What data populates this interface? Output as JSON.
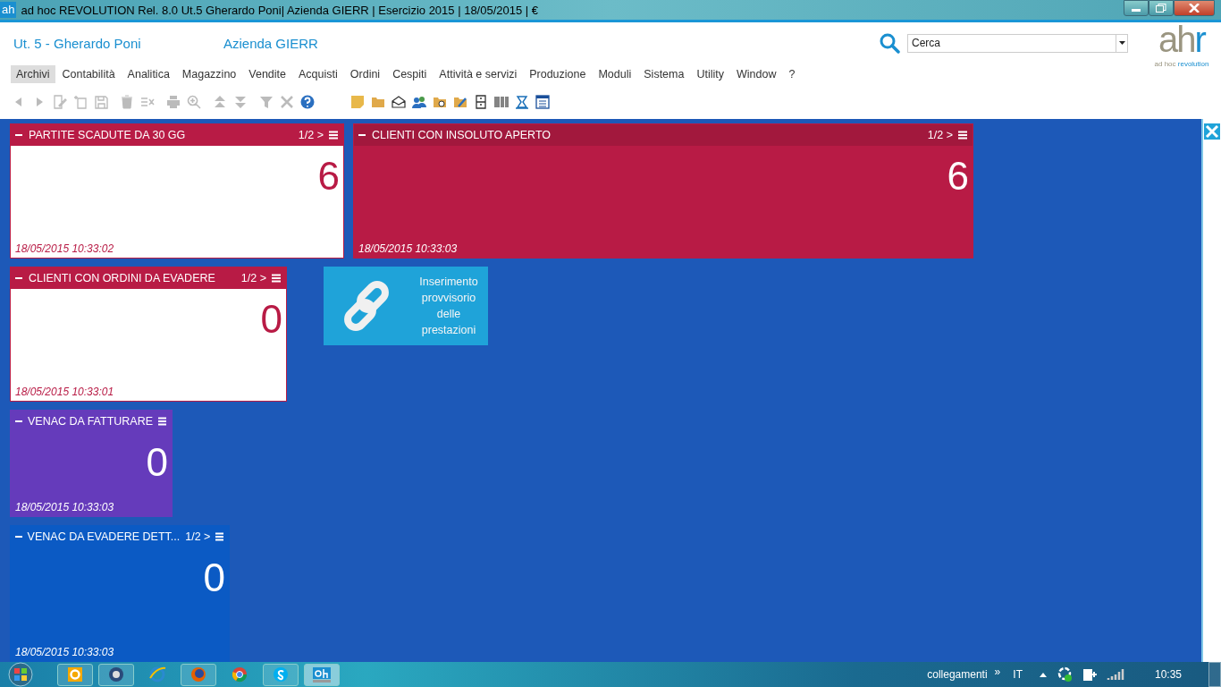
{
  "window": {
    "app_badge": "ah",
    "title": "ad hoc REVOLUTION Rel. 8.0 Ut.5 Gherardo Poni| Azienda GIERR | Esercizio 2015 | 18/05/2015 | €"
  },
  "header": {
    "user": "Ut. 5 - Gherardo Poni",
    "company": "Azienda GIERR",
    "search": {
      "value": "Cerca"
    },
    "logo": {
      "mark_main": "ah",
      "mark_accent": "r",
      "tagline_main": "ad hoc",
      "tagline_accent": "revolution"
    }
  },
  "menu": [
    {
      "label": "Archivi",
      "selected": true
    },
    {
      "label": "Contabilità",
      "selected": false
    },
    {
      "label": "Analitica",
      "selected": false
    },
    {
      "label": "Magazzino",
      "selected": false
    },
    {
      "label": "Vendite",
      "selected": false
    },
    {
      "label": "Acquisti",
      "selected": false
    },
    {
      "label": "Ordini",
      "selected": false
    },
    {
      "label": "Cespiti",
      "selected": false
    },
    {
      "label": "Attività e servizi",
      "selected": false
    },
    {
      "label": "Produzione",
      "selected": false
    },
    {
      "label": "Moduli",
      "selected": false
    },
    {
      "label": "Sistema",
      "selected": false
    },
    {
      "label": "Utility",
      "selected": false
    },
    {
      "label": "Window",
      "selected": false
    },
    {
      "label": "?",
      "selected": false
    }
  ],
  "widgets": [
    {
      "kind": "light",
      "title": "PARTITE SCADUTE DA 30 GG",
      "pager": "1/2 >",
      "value": "6",
      "timestamp": "18/05/2015 10:33:02",
      "color": "#b81b45"
    },
    {
      "kind": "filled",
      "title": "CLIENTI CON INSOLUTO APERTO",
      "pager": "1/2 >",
      "value": "6",
      "timestamp": "18/05/2015 10:33:03",
      "color": "#b81b45"
    },
    {
      "kind": "light",
      "title": "CLIENTI CON ORDINI DA EVADERE",
      "pager": "1/2 >",
      "value": "0",
      "timestamp": "18/05/2015 10:33:01",
      "color": "#b81b45"
    },
    {
      "kind": "filled",
      "title": "VENAC DA FATTURARE",
      "value": "0",
      "timestamp": "18/05/2015 10:33:03",
      "color": "#653bbb"
    },
    {
      "kind": "filled",
      "title": "VENAC DA EVADERE DETT...",
      "pager": "1/2 >",
      "value": "0",
      "timestamp": "18/05/2015 10:33:03",
      "color": "#0b5ac4"
    }
  ],
  "shortcut": {
    "label": "Inserimento provvisorio delle prestazioni"
  },
  "taskbar": {
    "toolbar": "collegamenti",
    "toolbar_more": "»",
    "language": "IT",
    "clock": "10:35"
  }
}
